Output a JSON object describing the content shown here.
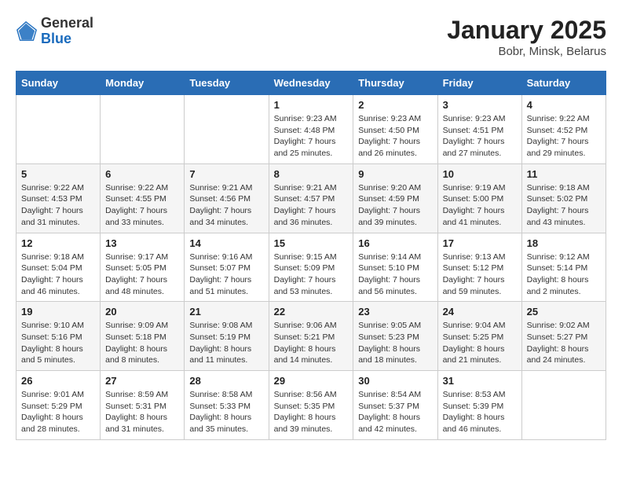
{
  "header": {
    "logo_general": "General",
    "logo_blue": "Blue",
    "title": "January 2025",
    "subtitle": "Bobr, Minsk, Belarus"
  },
  "weekdays": [
    "Sunday",
    "Monday",
    "Tuesday",
    "Wednesday",
    "Thursday",
    "Friday",
    "Saturday"
  ],
  "weeks": [
    [
      {
        "day": "",
        "info": ""
      },
      {
        "day": "",
        "info": ""
      },
      {
        "day": "",
        "info": ""
      },
      {
        "day": "1",
        "info": "Sunrise: 9:23 AM\nSunset: 4:48 PM\nDaylight: 7 hours and 25 minutes."
      },
      {
        "day": "2",
        "info": "Sunrise: 9:23 AM\nSunset: 4:50 PM\nDaylight: 7 hours and 26 minutes."
      },
      {
        "day": "3",
        "info": "Sunrise: 9:23 AM\nSunset: 4:51 PM\nDaylight: 7 hours and 27 minutes."
      },
      {
        "day": "4",
        "info": "Sunrise: 9:22 AM\nSunset: 4:52 PM\nDaylight: 7 hours and 29 minutes."
      }
    ],
    [
      {
        "day": "5",
        "info": "Sunrise: 9:22 AM\nSunset: 4:53 PM\nDaylight: 7 hours and 31 minutes."
      },
      {
        "day": "6",
        "info": "Sunrise: 9:22 AM\nSunset: 4:55 PM\nDaylight: 7 hours and 33 minutes."
      },
      {
        "day": "7",
        "info": "Sunrise: 9:21 AM\nSunset: 4:56 PM\nDaylight: 7 hours and 34 minutes."
      },
      {
        "day": "8",
        "info": "Sunrise: 9:21 AM\nSunset: 4:57 PM\nDaylight: 7 hours and 36 minutes."
      },
      {
        "day": "9",
        "info": "Sunrise: 9:20 AM\nSunset: 4:59 PM\nDaylight: 7 hours and 39 minutes."
      },
      {
        "day": "10",
        "info": "Sunrise: 9:19 AM\nSunset: 5:00 PM\nDaylight: 7 hours and 41 minutes."
      },
      {
        "day": "11",
        "info": "Sunrise: 9:18 AM\nSunset: 5:02 PM\nDaylight: 7 hours and 43 minutes."
      }
    ],
    [
      {
        "day": "12",
        "info": "Sunrise: 9:18 AM\nSunset: 5:04 PM\nDaylight: 7 hours and 46 minutes."
      },
      {
        "day": "13",
        "info": "Sunrise: 9:17 AM\nSunset: 5:05 PM\nDaylight: 7 hours and 48 minutes."
      },
      {
        "day": "14",
        "info": "Sunrise: 9:16 AM\nSunset: 5:07 PM\nDaylight: 7 hours and 51 minutes."
      },
      {
        "day": "15",
        "info": "Sunrise: 9:15 AM\nSunset: 5:09 PM\nDaylight: 7 hours and 53 minutes."
      },
      {
        "day": "16",
        "info": "Sunrise: 9:14 AM\nSunset: 5:10 PM\nDaylight: 7 hours and 56 minutes."
      },
      {
        "day": "17",
        "info": "Sunrise: 9:13 AM\nSunset: 5:12 PM\nDaylight: 7 hours and 59 minutes."
      },
      {
        "day": "18",
        "info": "Sunrise: 9:12 AM\nSunset: 5:14 PM\nDaylight: 8 hours and 2 minutes."
      }
    ],
    [
      {
        "day": "19",
        "info": "Sunrise: 9:10 AM\nSunset: 5:16 PM\nDaylight: 8 hours and 5 minutes."
      },
      {
        "day": "20",
        "info": "Sunrise: 9:09 AM\nSunset: 5:18 PM\nDaylight: 8 hours and 8 minutes."
      },
      {
        "day": "21",
        "info": "Sunrise: 9:08 AM\nSunset: 5:19 PM\nDaylight: 8 hours and 11 minutes."
      },
      {
        "day": "22",
        "info": "Sunrise: 9:06 AM\nSunset: 5:21 PM\nDaylight: 8 hours and 14 minutes."
      },
      {
        "day": "23",
        "info": "Sunrise: 9:05 AM\nSunset: 5:23 PM\nDaylight: 8 hours and 18 minutes."
      },
      {
        "day": "24",
        "info": "Sunrise: 9:04 AM\nSunset: 5:25 PM\nDaylight: 8 hours and 21 minutes."
      },
      {
        "day": "25",
        "info": "Sunrise: 9:02 AM\nSunset: 5:27 PM\nDaylight: 8 hours and 24 minutes."
      }
    ],
    [
      {
        "day": "26",
        "info": "Sunrise: 9:01 AM\nSunset: 5:29 PM\nDaylight: 8 hours and 28 minutes."
      },
      {
        "day": "27",
        "info": "Sunrise: 8:59 AM\nSunset: 5:31 PM\nDaylight: 8 hours and 31 minutes."
      },
      {
        "day": "28",
        "info": "Sunrise: 8:58 AM\nSunset: 5:33 PM\nDaylight: 8 hours and 35 minutes."
      },
      {
        "day": "29",
        "info": "Sunrise: 8:56 AM\nSunset: 5:35 PM\nDaylight: 8 hours and 39 minutes."
      },
      {
        "day": "30",
        "info": "Sunrise: 8:54 AM\nSunset: 5:37 PM\nDaylight: 8 hours and 42 minutes."
      },
      {
        "day": "31",
        "info": "Sunrise: 8:53 AM\nSunset: 5:39 PM\nDaylight: 8 hours and 46 minutes."
      },
      {
        "day": "",
        "info": ""
      }
    ]
  ]
}
